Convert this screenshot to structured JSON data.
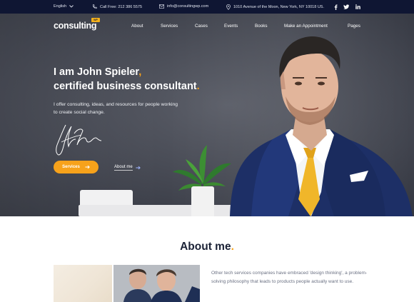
{
  "topbar": {
    "language": "English",
    "phone": "Call Free: 212 386 5575",
    "email": "info@consultingwp.com",
    "address": "1010 Avenue of the Moon, New York, NY 10018 US."
  },
  "header": {
    "logo": "consulting",
    "logo_badge": "WP",
    "nav": [
      "About",
      "Services",
      "Cases",
      "Events",
      "Books",
      "Make an Appointment",
      "Pages"
    ]
  },
  "hero": {
    "headline_line1": "I am John Spieler",
    "headline_line2": "certified business consultant",
    "intro": "I offer consulting, ideas, and resources for people working to create social change.",
    "services_button": "Services",
    "about_link": "About me"
  },
  "about": {
    "title": "About me",
    "text": "Other tech services companies have embraced 'design thinking', a problem-solving philosophy that leads to products people actually want to use."
  },
  "colors": {
    "accent": "#f7a21b",
    "topbar": "#0f1633",
    "heading": "#1b2236"
  }
}
